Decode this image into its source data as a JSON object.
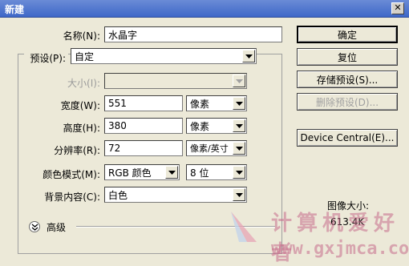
{
  "window": {
    "title": "新建"
  },
  "form": {
    "name": {
      "label": "名称(N):",
      "value": "水晶字"
    },
    "preset": {
      "label": "预设(P):",
      "value": "自定"
    },
    "size": {
      "label": "大小(I):",
      "value": ""
    },
    "width": {
      "label": "宽度(W):",
      "value": "551",
      "unit": "像素"
    },
    "height": {
      "label": "高度(H):",
      "value": "380",
      "unit": "像素"
    },
    "resolution": {
      "label": "分辨率(R):",
      "value": "72",
      "unit": "像素/英寸"
    },
    "color_mode": {
      "label": "颜色模式(M):",
      "value": "RGB 颜色",
      "depth": "8 位"
    },
    "background": {
      "label": "背景内容(C):",
      "value": "白色"
    },
    "advanced_label": "高级"
  },
  "buttons": {
    "ok": "确定",
    "reset": "复位",
    "save_preset": "存储预设(S)...",
    "delete_preset": "删除预设(D)...",
    "device_central": "Device Central(E)..."
  },
  "image_size": {
    "label": "图像大小:",
    "value": "613.4K"
  },
  "watermark": {
    "text": "计算机爱好者",
    "url": "www.gxjmca.com"
  }
}
